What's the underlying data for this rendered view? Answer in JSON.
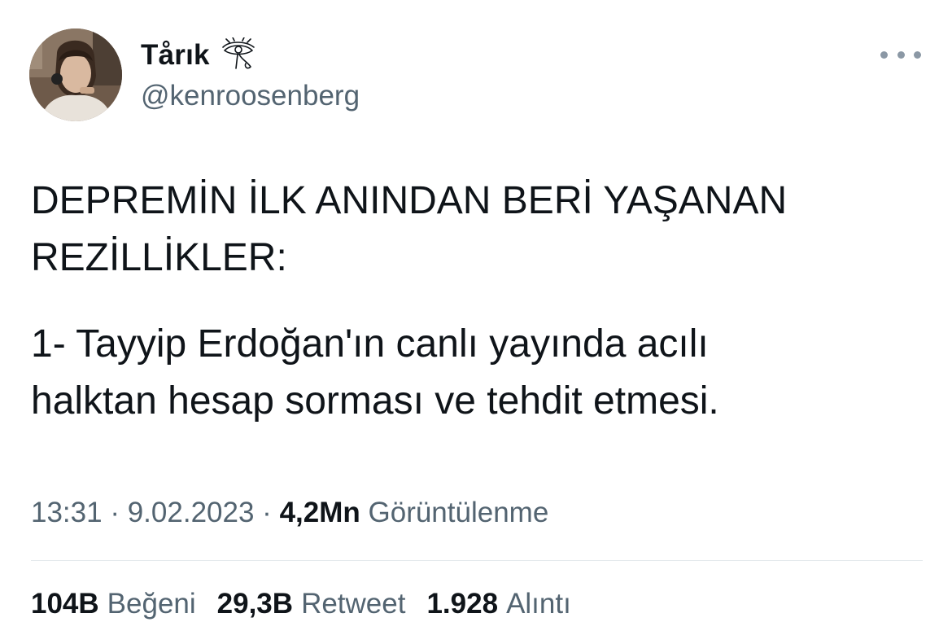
{
  "author": {
    "display_name": "Tårık",
    "handle": "@kenroosenberg",
    "name_emoji": "eye-of-horus-icon",
    "avatar": "profile-photo"
  },
  "tweet": {
    "paragraphs": [
      "DEPREMİN İLK ANINDAN BERİ YAŞANAN\nREZİLLİKLER:",
      "1- Tayyip Erdoğan'ın canlı yayında acılı\nhalktan hesap sorması ve tehdit etmesi."
    ]
  },
  "meta": {
    "time": "13:31",
    "separator": "·",
    "date": "9.02.2023",
    "views_count": "4,2Mn",
    "views_label": "Görüntülenme"
  },
  "stats": {
    "likes_count": "104B",
    "likes_label": "Beğeni",
    "retweets_count": "29,3B",
    "retweets_label": "Retweet",
    "quotes_count": "1.928",
    "quotes_label": "Alıntı"
  },
  "colors": {
    "text_primary": "#0f1419",
    "text_secondary": "#536471",
    "divider": "#e4e9ec",
    "more_dots": "#8b98a5"
  }
}
